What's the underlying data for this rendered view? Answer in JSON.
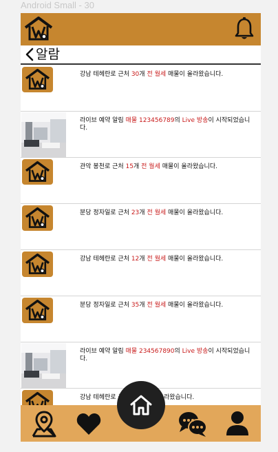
{
  "frame_label": "Android Small - 30",
  "header": {
    "logo_icon": "house-logo-icon",
    "bell_icon": "bell-icon",
    "accent_color": "#c6862f"
  },
  "titlebar": {
    "back_icon": "chevron-left-icon",
    "title": "알람"
  },
  "notifications": [
    {
      "thumb": "house-logo",
      "parts": [
        "강남 테헤란로 근처 ",
        "30",
        "개 ",
        "전 월세",
        " 매물이 올라왔습니다."
      ]
    },
    {
      "thumb": "photo-room",
      "parts": [
        "라이브 예약 알림 ",
        "매물 123456789",
        "의 ",
        "Live 방송",
        "이 시작되었습니다."
      ]
    },
    {
      "thumb": "house-logo",
      "parts": [
        "관악 봉천로 근처 ",
        "15",
        "개 ",
        "전 월세",
        " 매물이 올라왔습니다."
      ]
    },
    {
      "thumb": "house-logo",
      "parts": [
        "분당 정자일로 근처 ",
        "23",
        "개 ",
        "전 월세",
        " 매물이 올라왔습니다."
      ]
    },
    {
      "thumb": "house-logo",
      "parts": [
        "강남 테헤란로 근처 ",
        "12",
        "개 ",
        "전 월세",
        " 매물이 올라왔습니다."
      ]
    },
    {
      "thumb": "house-logo",
      "parts": [
        "분당 정자일로 근처 ",
        "35",
        "개 ",
        "전 월세",
        " 매물이 올라왔습니다."
      ]
    },
    {
      "thumb": "photo-room",
      "parts": [
        "라이브 예약 알림 ",
        "매물 234567890",
        "의 ",
        "Live 방송",
        "이 시작되었습니다."
      ]
    },
    {
      "thumb": "house-logo",
      "parts": [
        "강남 테헤란로 근처 ",
        "",
        "",
        "",
        "세 매물이 올라왔습니다."
      ]
    }
  ],
  "bottom_nav": {
    "items": [
      "map-pin-icon",
      "heart-icon",
      "home-icon",
      "chat-bubbles-icon",
      "user-icon"
    ],
    "color": "#e2a75a"
  }
}
